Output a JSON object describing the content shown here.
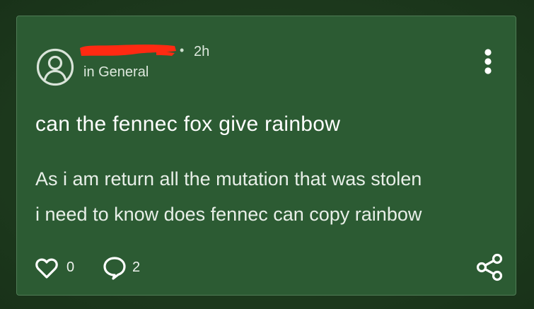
{
  "post": {
    "author": "",
    "separator": "•",
    "time": "2h",
    "subforum": "in General",
    "title": "can the fennec fox give rainbow",
    "body_line_1": "As i am return all the mutation that was stolen",
    "body_line_2": "i need to know does fennec can copy rainbow"
  },
  "actions": {
    "like_count": "0",
    "comment_count": "2"
  },
  "icons": {
    "avatar": "user-circle-icon",
    "menu": "more-vertical-icon",
    "like": "heart-icon",
    "comment": "comment-icon",
    "share": "share-icon"
  },
  "colors": {
    "background": "#1f3f1f",
    "card": "#2c5b33",
    "card_border": "#4f7b55",
    "redaction": "#ff2a12",
    "text": "#ffffff"
  }
}
